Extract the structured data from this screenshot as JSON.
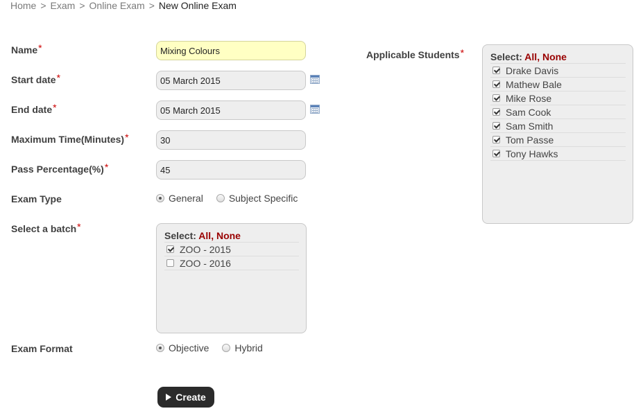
{
  "breadcrumb": {
    "items": [
      "Home",
      "Exam",
      "Online Exam"
    ],
    "separator": ">",
    "current": "New Online Exam"
  },
  "form": {
    "required_mark": "*",
    "name": {
      "label": "Name",
      "value": "Mixing Colours"
    },
    "start_date": {
      "label": "Start date",
      "value": "05 March 2015",
      "icon": "calendar-icon"
    },
    "end_date": {
      "label": "End date",
      "value": "05 March 2015",
      "icon": "calendar-icon"
    },
    "max_time": {
      "label": "Maximum Time(Minutes)",
      "value": "30"
    },
    "pass_percentage": {
      "label": "Pass Percentage(%)",
      "value": "45"
    },
    "exam_type": {
      "label": "Exam Type",
      "options": [
        {
          "label": "General",
          "selected": true
        },
        {
          "label": "Subject Specific",
          "selected": false
        }
      ]
    },
    "batch": {
      "label": "Select a batch",
      "select_prefix": "Select:",
      "all": "All",
      "none": "None",
      "items": [
        {
          "label": "ZOO - 2015",
          "checked": true
        },
        {
          "label": "ZOO - 2016",
          "checked": false
        }
      ]
    },
    "exam_format": {
      "label": "Exam Format",
      "options": [
        {
          "label": "Objective",
          "selected": true
        },
        {
          "label": "Hybrid",
          "selected": false
        }
      ]
    },
    "students": {
      "label": "Applicable Students",
      "select_prefix": "Select:",
      "all": "All",
      "none": "None",
      "items": [
        {
          "label": "Drake Davis",
          "checked": true
        },
        {
          "label": "Mathew Bale",
          "checked": true
        },
        {
          "label": "Mike Rose",
          "checked": true
        },
        {
          "label": "Sam Cook",
          "checked": true
        },
        {
          "label": "Sam Smith",
          "checked": true
        },
        {
          "label": "Tom Passe",
          "checked": true
        },
        {
          "label": "Tony Hawks",
          "checked": true
        }
      ]
    },
    "create_button": {
      "label": "Create",
      "icon": "play-icon"
    }
  },
  "colors": {
    "highlight_field": "#ffffc3",
    "field_bg": "#eeeeee",
    "required": "#cc0000",
    "link": "#990000",
    "button_bg": "#2b2b2b"
  }
}
